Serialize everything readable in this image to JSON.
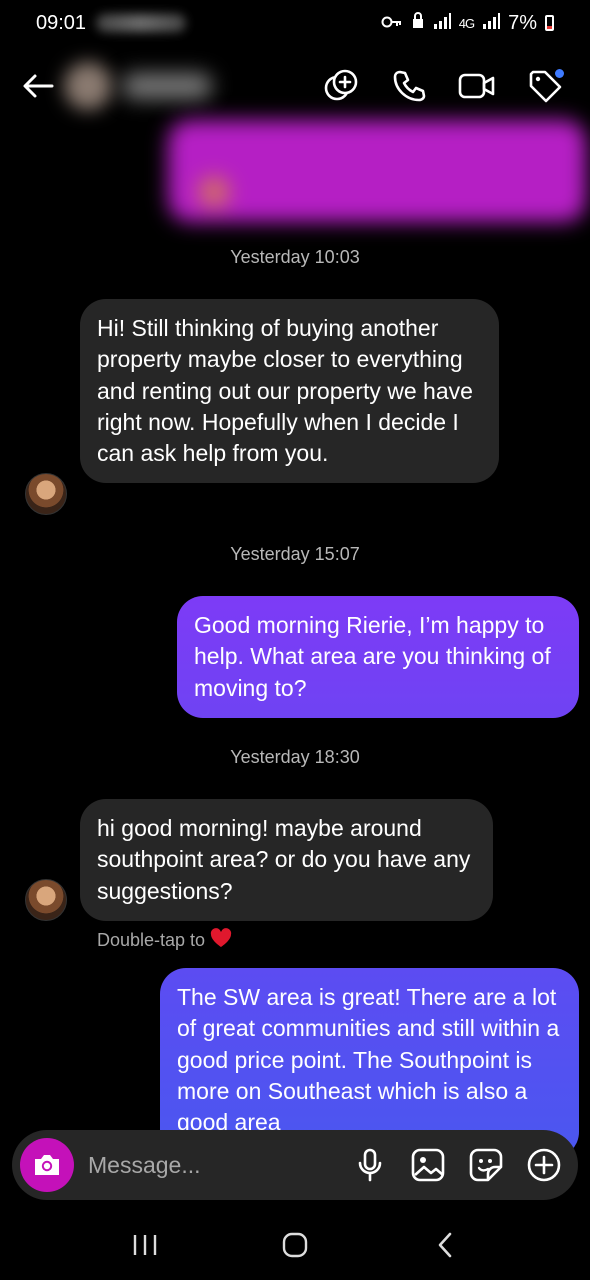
{
  "status_bar": {
    "time": "09:01",
    "network": "4G",
    "battery": "7%"
  },
  "header": {
    "contact_name": "",
    "actions": [
      "add-person-icon",
      "phone-icon",
      "video-icon",
      "tag-icon"
    ]
  },
  "messages": [
    {
      "type": "timestamp",
      "text": "Yesterday 10:03"
    },
    {
      "type": "incoming",
      "text": "Hi! Still thinking of buying another property maybe closer to everything and renting out our property we have right now. Hopefully when I decide I can ask help from you."
    },
    {
      "type": "timestamp",
      "text": "Yesterday 15:07"
    },
    {
      "type": "outgoing",
      "text": "Good morning Rierie, I’m happy to help. What area are you thinking of moving to?"
    },
    {
      "type": "timestamp",
      "text": "Yesterday 18:30"
    },
    {
      "type": "incoming",
      "text": "hi good morning! maybe around southpoint area? or do you have any suggestions?"
    },
    {
      "type": "outgoing",
      "text": "The SW area is great! There are a lot of great communities and still within a good price point. The Southpoint is more on Southeast which is also a good area"
    }
  ],
  "double_tap_hint": "Double-tap to",
  "composer": {
    "placeholder": "Message..."
  },
  "colors": {
    "background": "#000000",
    "incoming_bubble": "#262626",
    "outgoing_bubble_top": "#7b3cf5",
    "outgoing_bubble_bottom": "#4f55f0",
    "camera_button": "#c411b9"
  }
}
